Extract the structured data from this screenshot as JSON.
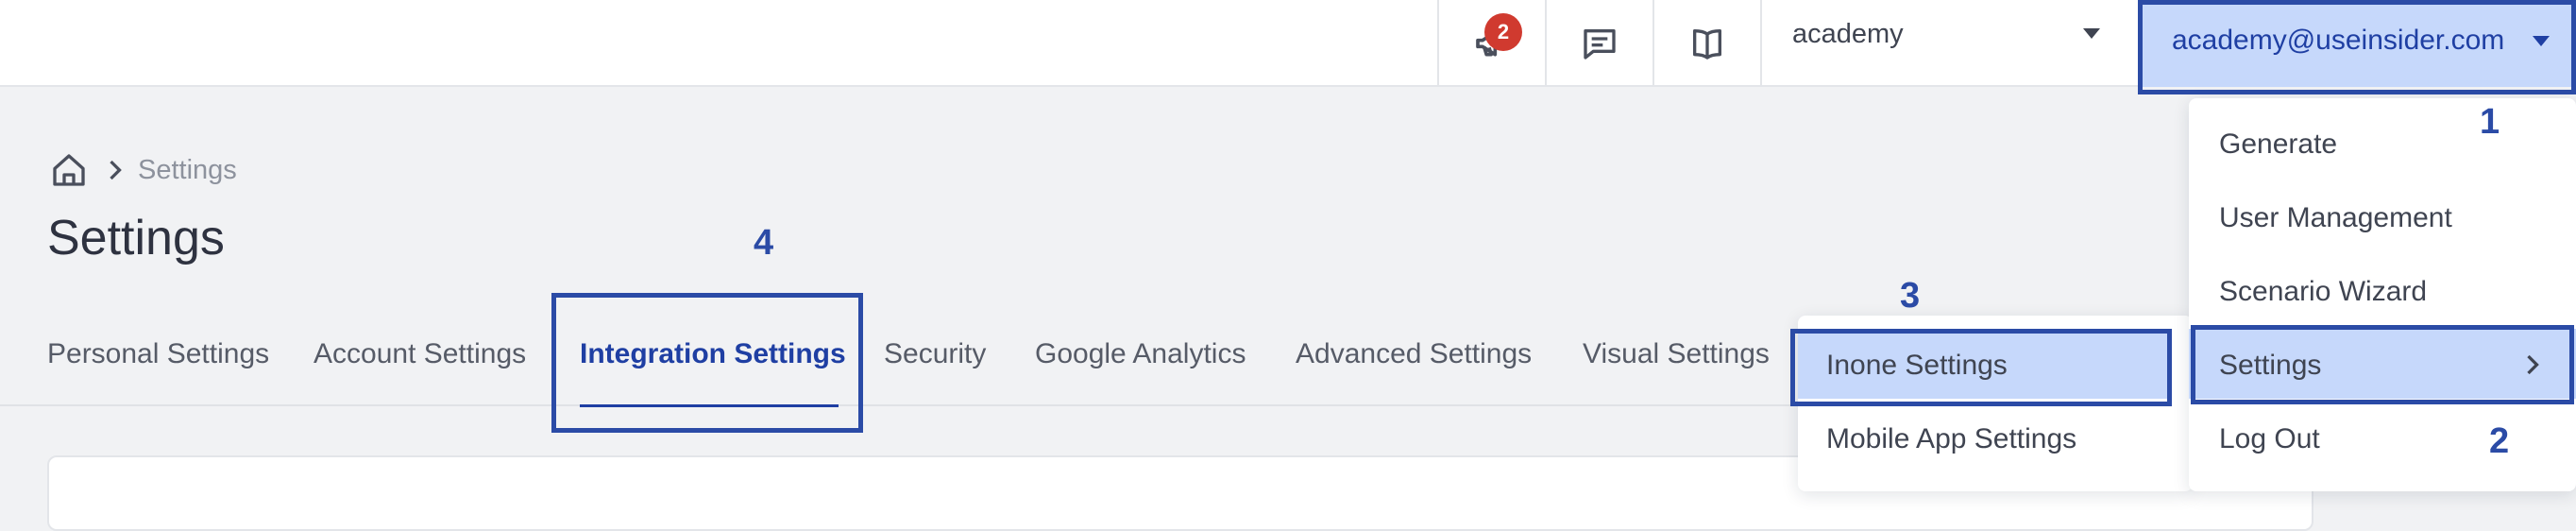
{
  "header": {
    "notifications_badge": "2",
    "account_select_value": "academy",
    "user_email": "academy@useinsider.com",
    "icons": [
      "megaphone-icon",
      "chat-icon",
      "book-icon",
      "home-icon"
    ]
  },
  "breadcrumb": {
    "current": "Settings"
  },
  "page": {
    "title": "Settings"
  },
  "tabs": [
    {
      "label": "Personal Settings"
    },
    {
      "label": "Account Settings"
    },
    {
      "label": "Integration Settings",
      "active": true
    },
    {
      "label": "Security"
    },
    {
      "label": "Google Analytics"
    },
    {
      "label": "Advanced Settings"
    },
    {
      "label": "Visual Settings"
    }
  ],
  "user_menu": {
    "items": [
      {
        "label": "Generate"
      },
      {
        "label": "User Management"
      },
      {
        "label": "Scenario Wizard"
      },
      {
        "label": "Settings",
        "highlighted": true,
        "has_submenu": true
      },
      {
        "label": "Log Out"
      }
    ]
  },
  "settings_submenu": {
    "items": [
      {
        "label": "Inone Settings",
        "highlighted": true
      },
      {
        "label": "Mobile App Settings"
      }
    ]
  },
  "annotations": [
    "1",
    "2",
    "3",
    "4"
  ],
  "colors": {
    "accent": "#1f3fa3",
    "highlight": "#c6d8fb",
    "annotation": "#2b4ba6",
    "badge": "#d03a2f",
    "background": "#f1f2f4"
  }
}
